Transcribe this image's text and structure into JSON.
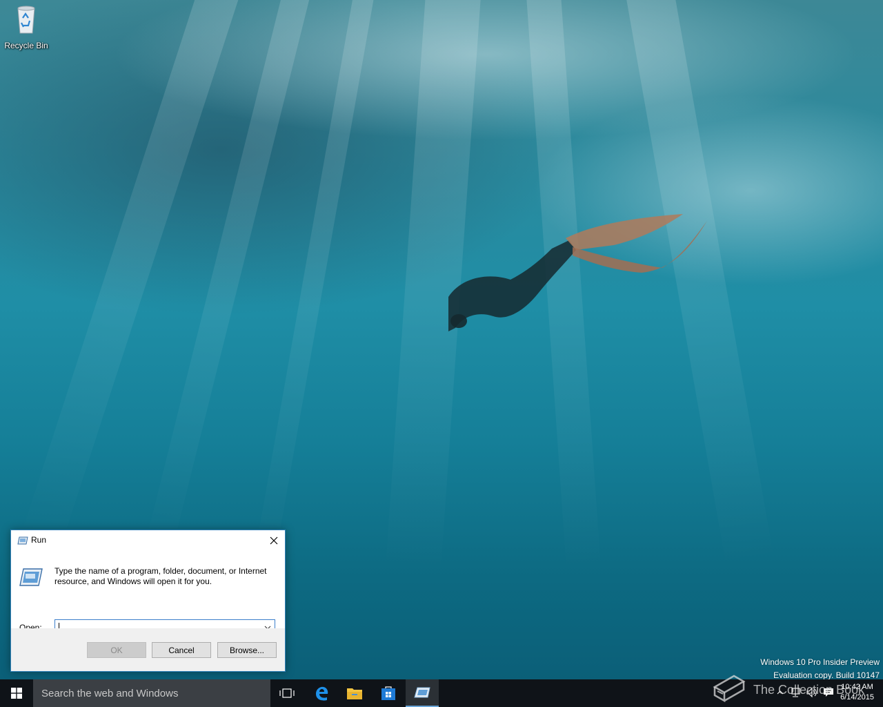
{
  "desktop": {
    "icons": [
      {
        "label": "Recycle Bin",
        "icon": "recycle-bin-icon"
      }
    ],
    "watermark": {
      "line1": "Windows 10 Pro Insider Preview",
      "line2": "Evaluation copy. Build 10147"
    },
    "overlay_brand": "The Collection Book"
  },
  "run_dialog": {
    "title": "Run",
    "description": "Type the name of a program, folder, document, or Internet resource, and Windows will open it for you.",
    "open_label": "Open:",
    "open_value": "",
    "buttons": {
      "ok": "OK",
      "cancel": "Cancel",
      "browse": "Browse..."
    },
    "ok_disabled": true
  },
  "taskbar": {
    "search_placeholder": "Search the web and Windows",
    "pinned": [
      {
        "name": "task-view",
        "icon": "task-view-icon"
      },
      {
        "name": "edge",
        "icon": "edge-icon"
      },
      {
        "name": "file-explorer",
        "icon": "folder-icon"
      },
      {
        "name": "store",
        "icon": "store-icon"
      },
      {
        "name": "run",
        "icon": "run-icon",
        "active": true
      }
    ],
    "tray": {
      "time": "10:42 AM",
      "date": "6/14/2015"
    }
  },
  "colors": {
    "taskbar": "#0f1318",
    "search_box": "#3b3f44",
    "accent": "#6aa6d9",
    "dialog_border": "#2f7fb7"
  }
}
